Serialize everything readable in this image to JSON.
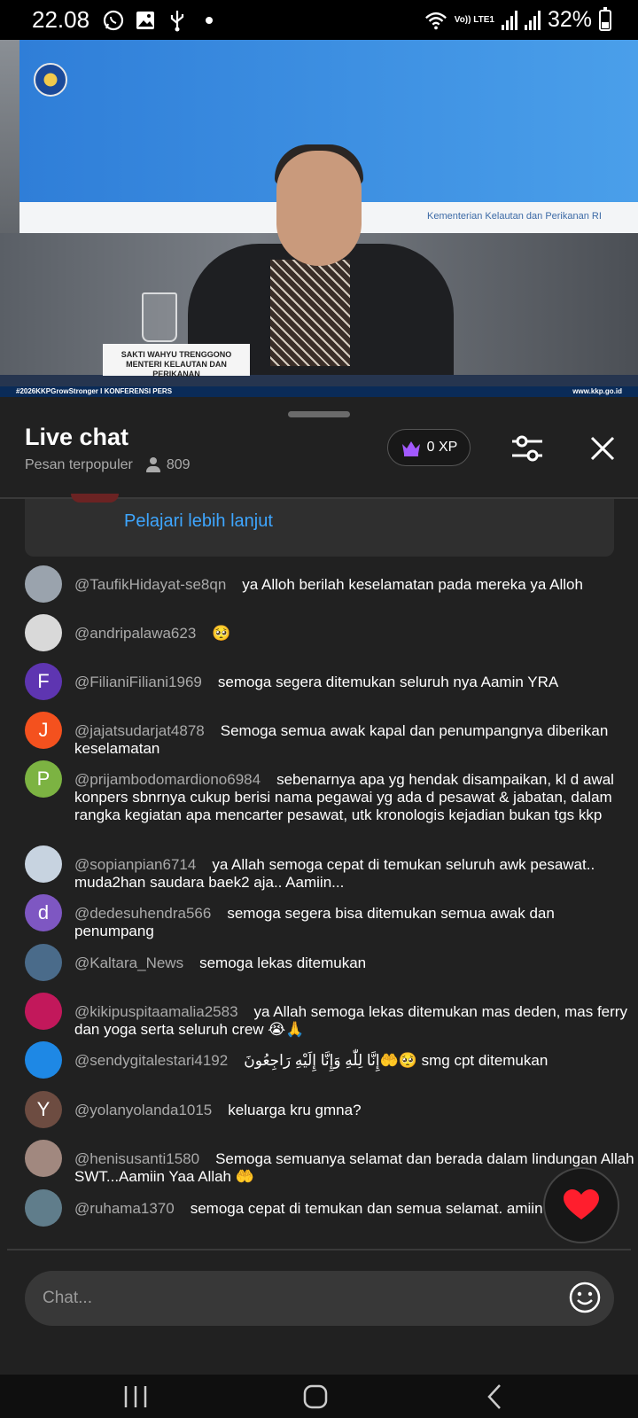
{
  "status_bar": {
    "time": "22.08",
    "network": "Vo)) LTE1",
    "battery_text": "32%",
    "battery_level": 0.32,
    "icons": [
      "whatsapp-icon",
      "gallery-icon",
      "usb-icon",
      "dot-icon",
      "wifi-icon",
      "signal-icon",
      "battery-icon"
    ]
  },
  "video": {
    "nameplate_line1": "SAKTI WAHYU TRENGGONO",
    "nameplate_line2": "MENTERI KELAUTAN DAN PERIKANAN",
    "ticker_left": "#2026KKPGrowStronger I KONFERENSI PERS",
    "ticker_right": "www.kkp.go.id",
    "screen_text": "Kementerian Kelautan dan Perikanan RI"
  },
  "chat": {
    "title": "Live chat",
    "filter_label": "Pesan terpopuler",
    "viewer_count": "809",
    "xp": "0 XP",
    "learn_more": "Pelajari lebih lanjut",
    "input_placeholder": "Chat...",
    "messages": [
      {
        "author": "@TaufikHidayat-se8qn",
        "text": "ya Alloh berilah keselamatan pada mereka ya Alloh",
        "avatar_letter": "",
        "avatar_color": "#9aa3ad"
      },
      {
        "author": "@andripalawa623",
        "text": "🥺",
        "avatar_letter": "",
        "avatar_color": "#d9d9d9"
      },
      {
        "author": "@FilianiFiliani1969",
        "text": "semoga segera ditemukan seluruh nya Aamin YRA",
        "avatar_letter": "F",
        "avatar_color": "#5e35b1"
      },
      {
        "author": "@jajatsudarjat4878",
        "text": "Semoga semua awak kapal dan penumpangnya diberikan keselamatan",
        "avatar_letter": "J",
        "avatar_color": "#f4511e"
      },
      {
        "author": "@prijambodomardiono6984",
        "text": "sebenarnya apa yg hendak disampaikan, kl d awal konpers sbnrnya cukup berisi nama pegawai yg ada d pesawat & jabatan, dalam rangka kegiatan apa mencarter pesawat, utk kronologis kejadian bukan tgs kkp",
        "avatar_letter": "P",
        "avatar_color": "#7cb342"
      },
      {
        "author": "@sopianpian6714",
        "text": "ya Allah semoga cepat di temukan seluruh awk pesawat.. muda2han saudara baek2 aja.. Aamiin...",
        "avatar_letter": "",
        "avatar_color": "#c7d3e0"
      },
      {
        "author": "@dedesuhendra566",
        "text": "semoga segera bisa ditemukan semua awak dan penumpang",
        "avatar_letter": "d",
        "avatar_color": "#7e57c2"
      },
      {
        "author": "@Kaltara_News",
        "text": "semoga lekas ditemukan",
        "avatar_letter": "",
        "avatar_color": "#4a6b8a"
      },
      {
        "author": "@kikipuspitaamalia2583",
        "text": "ya Allah semoga lekas ditemukan mas deden, mas ferry dan yoga serta seluruh crew 😭🙏",
        "avatar_letter": "",
        "avatar_color": "#c2185b"
      },
      {
        "author": "@sendygitalestari4192",
        "text": "إِنَّا لِلّٰهِ وَإِنَّا إِلَيْهِ رَاجِعُونَ🤲🥺 smg cpt ditemukan",
        "avatar_letter": "",
        "avatar_color": "#1e88e5"
      },
      {
        "author": "@yolanyolanda1015",
        "text": "keluarga kru gmna?",
        "avatar_letter": "Y",
        "avatar_color": "#6d4c41"
      },
      {
        "author": "@henisusanti1580",
        "text": "Semoga semuanya selamat dan berada dalam lindungan Allah SWT...Aamiin Yaa Allah 🤲",
        "avatar_letter": "",
        "avatar_color": "#a1887f"
      },
      {
        "author": "@ruhama1370",
        "text": "semoga cepat di temukan dan semua selamat. amiin.",
        "avatar_letter": "",
        "avatar_color": "#607d8b"
      }
    ]
  },
  "colors": {
    "panel_bg": "#212121",
    "link": "#3ea6ff",
    "author": "#aaaaaa",
    "heart": "#ff1e2d",
    "crown": "#a259ff"
  }
}
